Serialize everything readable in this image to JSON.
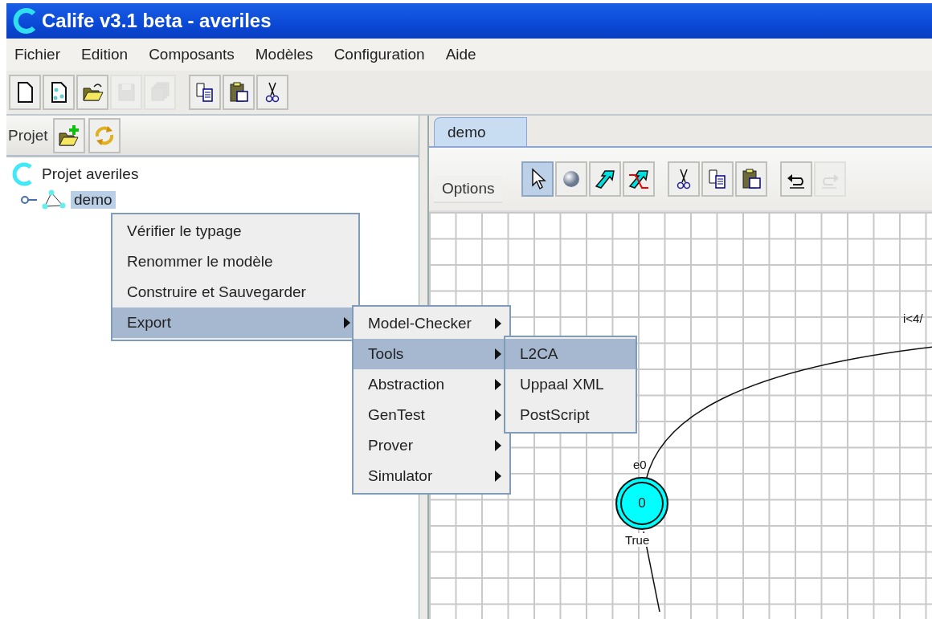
{
  "window": {
    "title": "Calife v3.1 beta - averiles"
  },
  "menu_bar": [
    "Fichier",
    "Edition",
    "Composants",
    "Modèles",
    "Configuration",
    "Aide"
  ],
  "main_toolbar": [
    [
      {
        "kind": "new",
        "disabled": false
      },
      {
        "kind": "model",
        "disabled": false
      },
      {
        "kind": "open",
        "disabled": false
      },
      {
        "kind": "save",
        "disabled": true
      },
      {
        "kind": "save-all",
        "disabled": true
      }
    ],
    [
      {
        "kind": "copy",
        "disabled": false
      },
      {
        "kind": "paste",
        "disabled": false
      },
      {
        "kind": "cut",
        "disabled": false
      }
    ]
  ],
  "project_panel": {
    "label": "Projet",
    "tools": [
      {
        "kind": "add-folder",
        "disabled": false
      },
      {
        "kind": "refresh",
        "disabled": false
      }
    ]
  },
  "tree": {
    "label": "Projet averiles",
    "children": [
      {
        "label": "demo",
        "selected": true
      }
    ]
  },
  "context_menu": {
    "items": [
      {
        "label": "Vérifier le typage",
        "has_submenu": false,
        "selected": false
      },
      {
        "label": "Renommer le modèle",
        "has_submenu": false,
        "selected": false
      },
      {
        "label": "Construire et Sauvegarder",
        "has_submenu": false,
        "selected": false
      },
      {
        "label": "Export",
        "has_submenu": true,
        "selected": true
      }
    ]
  },
  "submenu": {
    "items": [
      {
        "label": "Model-Checker",
        "has_submenu": true,
        "selected": false
      },
      {
        "label": "Tools",
        "has_submenu": true,
        "selected": true
      },
      {
        "label": "Abstraction",
        "has_submenu": true,
        "selected": false
      },
      {
        "label": "GenTest",
        "has_submenu": true,
        "selected": false
      },
      {
        "label": "Prover",
        "has_submenu": true,
        "selected": false
      },
      {
        "label": "Simulator",
        "has_submenu": true,
        "selected": false
      }
    ]
  },
  "tools_submenu": {
    "items": [
      {
        "label": "L2CA",
        "has_submenu": false,
        "selected": true
      },
      {
        "label": "Uppaal XML",
        "has_submenu": false,
        "selected": false
      },
      {
        "label": "PostScript",
        "has_submenu": false,
        "selected": false
      }
    ]
  },
  "editor": {
    "tabs": [
      {
        "label": "demo",
        "selected": true
      }
    ],
    "options_label": "Options",
    "tools": [
      [
        {
          "kind": "pointer",
          "selected": true,
          "disabled": false
        },
        {
          "kind": "state",
          "selected": false,
          "disabled": false
        },
        {
          "kind": "transition",
          "selected": false,
          "disabled": false
        },
        {
          "kind": "transition-delete",
          "selected": false,
          "disabled": false
        }
      ],
      [
        {
          "kind": "cut",
          "selected": false,
          "disabled": false
        },
        {
          "kind": "copy",
          "selected": false,
          "disabled": false
        },
        {
          "kind": "paste",
          "selected": false,
          "disabled": false
        }
      ],
      [
        {
          "kind": "undo",
          "selected": false,
          "disabled": false
        },
        {
          "kind": "redo",
          "selected": false,
          "disabled": true
        }
      ]
    ],
    "state": {
      "name": "e0",
      "value": "0",
      "invariant": "True"
    },
    "transition": {
      "label": "i<4/"
    }
  }
}
